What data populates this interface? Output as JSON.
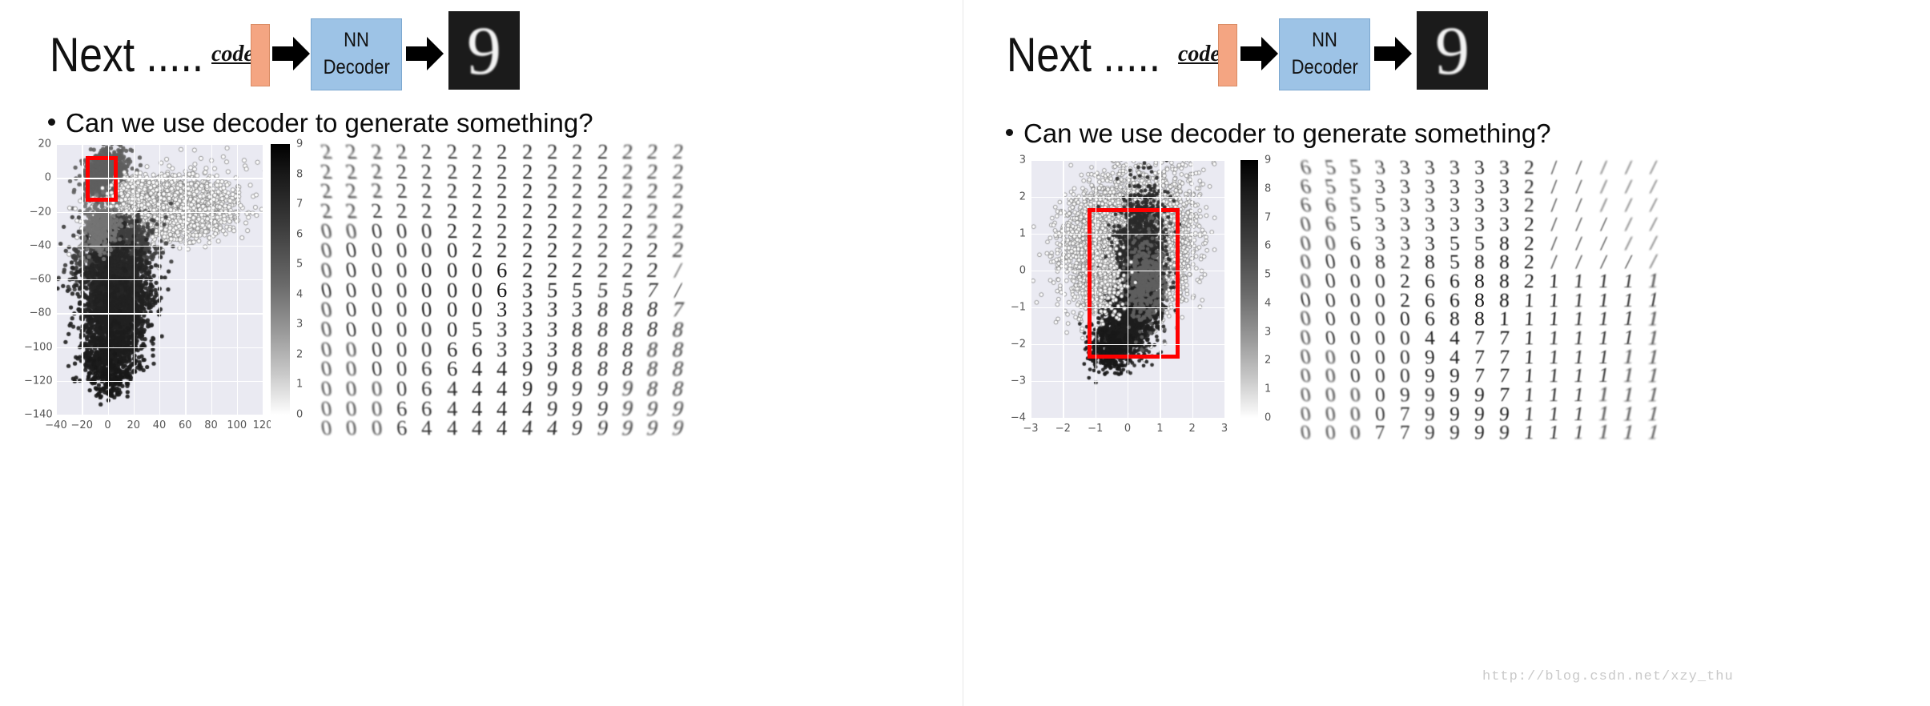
{
  "slide": {
    "next_title": "Next .....",
    "bullet_text": "Can we use decoder to generate something?",
    "bullet_marker": "•",
    "code_label": "code",
    "nn_line1": "NN",
    "nn_line2": "Decoder",
    "output_digit": "9",
    "colors": {
      "code_bar": "#f4a582",
      "nn_box": "#9dc3e6",
      "arrow": "#000000",
      "redbox": "#ff0000",
      "axes_bg": "#eaeaf2",
      "grid": "#ffffff",
      "tick_text": "#555555"
    }
  },
  "watermark": "http://blog.csdn.net/xzy_thu",
  "chart_data": [
    {
      "id": "left-scatter",
      "type": "scatter",
      "title": "",
      "xlabel": "",
      "ylabel": "",
      "xlim": [
        -40,
        120
      ],
      "ylim": [
        -140,
        20
      ],
      "xticks": [
        "-40",
        "-20",
        "0",
        "20",
        "40",
        "60",
        "80",
        "100",
        "120"
      ],
      "xtick_values": [
        -40,
        -20,
        0,
        20,
        40,
        60,
        80,
        100,
        120
      ],
      "yticks": [
        "20",
        "0",
        "-20",
        "-40",
        "-60",
        "-80",
        "-100",
        "-120",
        "-140"
      ],
      "ytick_values": [
        20,
        0,
        -20,
        -40,
        -60,
        -80,
        -100,
        -120,
        -140
      ],
      "grid": true,
      "colorbar": {
        "label": "",
        "ticks": [
          "9",
          "8",
          "7",
          "6",
          "5",
          "4",
          "3",
          "2",
          "1",
          "0"
        ],
        "tick_values": [
          9,
          8,
          7,
          6,
          5,
          4,
          3,
          2,
          1,
          0
        ],
        "vmin": 0,
        "vmax": 9,
        "cmap": "gray_reversed"
      },
      "highlight_box": {
        "x0": -17,
        "x1": 8,
        "y0": -14,
        "y1": 13
      },
      "description": "t-SNE style autoencoder code space of MNIST, points shaded by digit label 0-9"
    },
    {
      "id": "right-scatter",
      "type": "scatter",
      "title": "",
      "xlabel": "",
      "ylabel": "",
      "xlim": [
        -3,
        3
      ],
      "ylim": [
        -4,
        3
      ],
      "xticks": [
        "-3",
        "-2",
        "-1",
        "0",
        "1",
        "2",
        "3"
      ],
      "xtick_values": [
        -3,
        -2,
        -1,
        0,
        1,
        2,
        3
      ],
      "yticks": [
        "3",
        "2",
        "1",
        "0",
        "-1",
        "-2",
        "-3",
        "-4"
      ],
      "ytick_values": [
        3,
        2,
        1,
        0,
        -1,
        -2,
        -3,
        -4
      ],
      "grid": true,
      "colorbar": {
        "label": "",
        "ticks": [
          "9",
          "8",
          "7",
          "6",
          "5",
          "4",
          "3",
          "2",
          "1",
          "0"
        ],
        "tick_values": [
          9,
          8,
          7,
          6,
          5,
          4,
          3,
          2,
          1,
          0
        ],
        "vmin": 0,
        "vmax": 9,
        "cmap": "gray_reversed"
      },
      "highlight_box": {
        "x0": -1.25,
        "x1": 1.6,
        "y0": -2.4,
        "y1": 1.7
      },
      "description": "VAE latent code space of MNIST, points shaded by digit label 0-9"
    },
    {
      "id": "left-manifold",
      "type": "heatmap",
      "title": "",
      "rows": 15,
      "cols": 15,
      "description": "Decoder generated MNIST digit manifold sampled over the highlighted code region",
      "digits": [
        [
          "2",
          "2",
          "2",
          "2",
          "2",
          "2",
          "2",
          "2",
          "2",
          "2",
          "2",
          "2",
          "2",
          "2",
          "2"
        ],
        [
          "2",
          "2",
          "2",
          "2",
          "2",
          "2",
          "2",
          "2",
          "2",
          "2",
          "2",
          "2",
          "2",
          "2",
          "2"
        ],
        [
          "2",
          "2",
          "2",
          "2",
          "2",
          "2",
          "2",
          "2",
          "2",
          "2",
          "2",
          "2",
          "2",
          "2",
          "2"
        ],
        [
          "2",
          "2",
          "2",
          "2",
          "2",
          "2",
          "2",
          "2",
          "2",
          "2",
          "2",
          "2",
          "2",
          "2",
          "2"
        ],
        [
          "0",
          "0",
          "0",
          "0",
          "0",
          "2",
          "2",
          "2",
          "2",
          "2",
          "2",
          "2",
          "2",
          "2",
          "2"
        ],
        [
          "0",
          "0",
          "0",
          "0",
          "0",
          "0",
          "2",
          "2",
          "2",
          "2",
          "2",
          "2",
          "2",
          "2",
          "2"
        ],
        [
          "0",
          "0",
          "0",
          "0",
          "0",
          "0",
          "0",
          "6",
          "2",
          "2",
          "2",
          "2",
          "2",
          "2",
          "/"
        ],
        [
          "0",
          "0",
          "0",
          "0",
          "0",
          "0",
          "0",
          "6",
          "3",
          "5",
          "5",
          "5",
          "5",
          "7",
          "/"
        ],
        [
          "0",
          "0",
          "0",
          "0",
          "0",
          "0",
          "0",
          "3",
          "3",
          "3",
          "3",
          "8",
          "8",
          "8",
          "7"
        ],
        [
          "0",
          "0",
          "0",
          "0",
          "0",
          "0",
          "5",
          "3",
          "3",
          "3",
          "8",
          "8",
          "8",
          "8",
          "8"
        ],
        [
          "0",
          "0",
          "0",
          "0",
          "0",
          "6",
          "6",
          "3",
          "3",
          "3",
          "8",
          "8",
          "8",
          "8",
          "8"
        ],
        [
          "0",
          "0",
          "0",
          "0",
          "6",
          "6",
          "4",
          "4",
          "9",
          "9",
          "8",
          "8",
          "8",
          "8",
          "8"
        ],
        [
          "0",
          "0",
          "0",
          "0",
          "6",
          "4",
          "4",
          "4",
          "9",
          "9",
          "9",
          "9",
          "9",
          "8",
          "8"
        ],
        [
          "0",
          "0",
          "0",
          "6",
          "6",
          "4",
          "4",
          "4",
          "4",
          "9",
          "9",
          "9",
          "9",
          "9",
          "9"
        ],
        [
          "0",
          "0",
          "0",
          "6",
          "4",
          "4",
          "4",
          "4",
          "4",
          "4",
          "9",
          "9",
          "9",
          "9",
          "9"
        ]
      ]
    },
    {
      "id": "right-manifold",
      "type": "heatmap",
      "title": "",
      "rows": 15,
      "cols": 15,
      "description": "VAE decoder generated MNIST digit manifold over the highlighted latent region",
      "digits": [
        [
          "6",
          "5",
          "5",
          "3",
          "3",
          "3",
          "3",
          "3",
          "3",
          "2",
          "/",
          "/",
          "/",
          "/",
          "/"
        ],
        [
          "6",
          "5",
          "5",
          "3",
          "3",
          "3",
          "3",
          "3",
          "3",
          "2",
          "/",
          "/",
          "/",
          "/",
          "/"
        ],
        [
          "6",
          "6",
          "5",
          "5",
          "3",
          "3",
          "3",
          "3",
          "3",
          "2",
          "/",
          "/",
          "/",
          "/",
          "/"
        ],
        [
          "0",
          "6",
          "5",
          "3",
          "3",
          "3",
          "3",
          "3",
          "3",
          "2",
          "/",
          "/",
          "/",
          "/",
          "/"
        ],
        [
          "0",
          "0",
          "6",
          "3",
          "3",
          "3",
          "5",
          "5",
          "8",
          "2",
          "/",
          "/",
          "/",
          "/",
          "/"
        ],
        [
          "0",
          "0",
          "0",
          "8",
          "2",
          "8",
          "5",
          "8",
          "8",
          "2",
          "/",
          "/",
          "/",
          "/",
          "/"
        ],
        [
          "0",
          "0",
          "0",
          "0",
          "2",
          "6",
          "6",
          "8",
          "8",
          "2",
          "1",
          "1",
          "1",
          "1",
          "1"
        ],
        [
          "0",
          "0",
          "0",
          "0",
          "2",
          "6",
          "6",
          "8",
          "8",
          "1",
          "1",
          "1",
          "1",
          "1",
          "1"
        ],
        [
          "0",
          "0",
          "0",
          "0",
          "0",
          "6",
          "8",
          "8",
          "1",
          "1",
          "1",
          "1",
          "1",
          "1",
          "1"
        ],
        [
          "0",
          "0",
          "0",
          "0",
          "0",
          "4",
          "4",
          "7",
          "7",
          "1",
          "1",
          "1",
          "1",
          "1",
          "1"
        ],
        [
          "0",
          "0",
          "0",
          "0",
          "0",
          "9",
          "4",
          "7",
          "7",
          "1",
          "1",
          "1",
          "1",
          "1",
          "1"
        ],
        [
          "0",
          "0",
          "0",
          "0",
          "0",
          "9",
          "9",
          "7",
          "7",
          "1",
          "1",
          "1",
          "1",
          "1",
          "1"
        ],
        [
          "0",
          "0",
          "0",
          "0",
          "9",
          "9",
          "9",
          "9",
          "7",
          "1",
          "1",
          "1",
          "1",
          "1",
          "1"
        ],
        [
          "0",
          "0",
          "0",
          "0",
          "7",
          "9",
          "9",
          "9",
          "9",
          "1",
          "1",
          "1",
          "1",
          "1",
          "1"
        ],
        [
          "0",
          "0",
          "0",
          "7",
          "7",
          "9",
          "9",
          "9",
          "9",
          "1",
          "1",
          "1",
          "1",
          "1",
          "1"
        ]
      ]
    }
  ]
}
